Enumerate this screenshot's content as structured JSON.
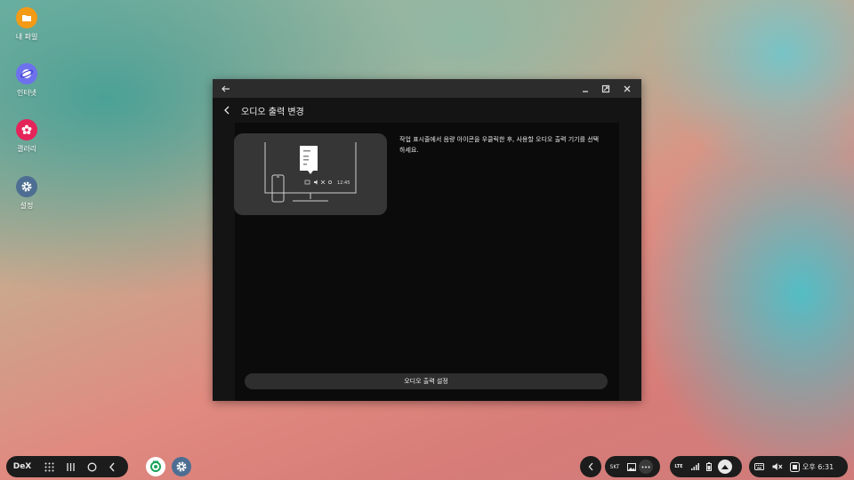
{
  "desktop": {
    "icons": [
      {
        "label": "내 파일",
        "icon": "folder-icon",
        "color": "#f39a16"
      },
      {
        "label": "인터넷",
        "icon": "internet-icon",
        "color": "#6e71ee"
      },
      {
        "label": "갤러리",
        "icon": "gallery-icon",
        "color": "#e5245a"
      },
      {
        "label": "설정",
        "icon": "settings-icon",
        "color": "#4d6e92"
      }
    ]
  },
  "window": {
    "page_title": "오디오 출력 변경",
    "description": "작업 표시줄에서 음량 아이콘을 우클릭한 후, 사용할 오디오 출력 기기를 선택하세요.",
    "illustration_time": "12:45",
    "action_button": "오디오 출력 설정"
  },
  "taskbar": {
    "dex_label": "DeX",
    "carrier": "SKT",
    "clock": "오후 6:31",
    "network_label": "LTE"
  },
  "colors": {
    "window_bg": "#0b0b0b",
    "titlebar": "#2c2c2c",
    "card": "#363636",
    "taskbar_pill": "#1c1c1c"
  }
}
